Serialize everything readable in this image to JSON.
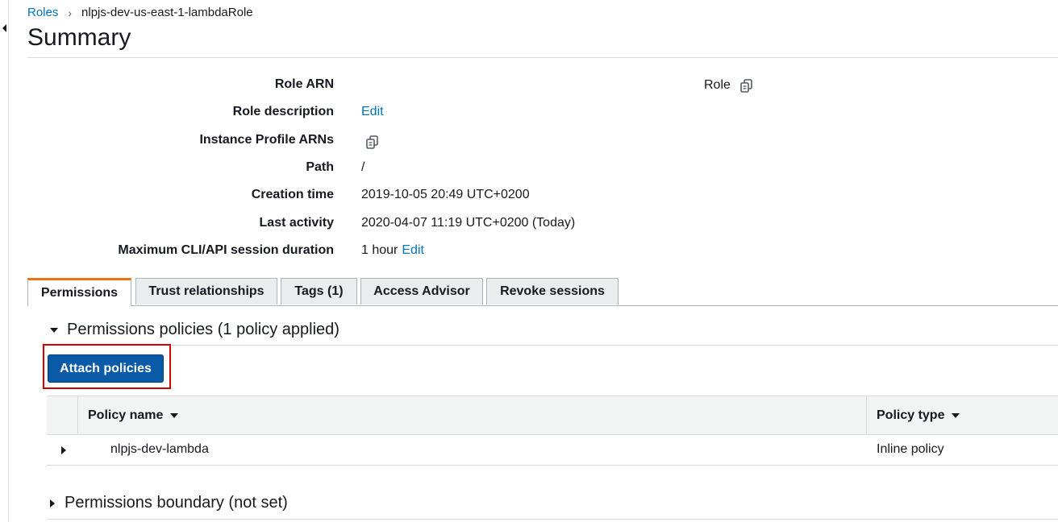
{
  "breadcrumb": {
    "parent": "Roles",
    "separator": "›",
    "current": "nlpjs-dev-us-east-1-lambdaRole"
  },
  "page": {
    "title": "Summary"
  },
  "summary": {
    "role_arn": {
      "label": "Role ARN",
      "value": "Role"
    },
    "role_description": {
      "label": "Role description",
      "link": "Edit"
    },
    "instance_profile": {
      "label": "Instance Profile ARNs"
    },
    "path": {
      "label": "Path",
      "value": "/"
    },
    "creation_time": {
      "label": "Creation time",
      "value": "2019-10-05 20:49 UTC+0200"
    },
    "last_activity": {
      "label": "Last activity",
      "value": "2020-04-07 11:19 UTC+0200 (Today)"
    },
    "max_session": {
      "label": "Maximum CLI/API session duration",
      "value": "1 hour",
      "link": "Edit"
    }
  },
  "tabs": [
    {
      "label": "Permissions",
      "active": true
    },
    {
      "label": "Trust relationships"
    },
    {
      "label": "Tags (1)"
    },
    {
      "label": "Access Advisor"
    },
    {
      "label": "Revoke sessions"
    }
  ],
  "permissions": {
    "policies_header": "Permissions policies (1 policy applied)",
    "attach_button": "Attach policies",
    "table": {
      "columns": [
        "Policy name",
        "Policy type"
      ],
      "rows": [
        {
          "name": "nlpjs-dev-lambda",
          "type": "Inline policy"
        }
      ]
    },
    "boundary_header": "Permissions boundary (not set)"
  },
  "colors": {
    "accent_link": "#0073bb",
    "primary_button": "#0b5aa8",
    "active_tab": "#ec7211",
    "highlight": "#d40000"
  }
}
